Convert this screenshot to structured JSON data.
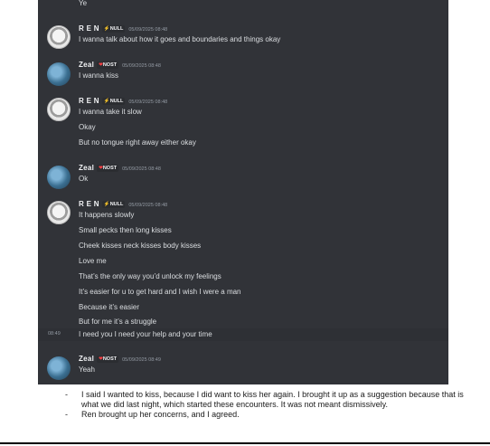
{
  "chat": {
    "top_fragment": "Ye",
    "hover_time": "08:49",
    "messages": [
      {
        "author": "R E N",
        "tag": "NULL",
        "timestamp": "05/09/2025 08:48",
        "lines": [
          "I wanna talk about how it goes and boundaries and things okay"
        ]
      },
      {
        "author": "Zeal",
        "tag": "NOST",
        "timestamp": "05/09/2025 08:48",
        "lines": [
          "I wanna kiss"
        ]
      },
      {
        "author": "R E N",
        "tag": "NULL",
        "timestamp": "05/09/2025 08:48",
        "lines": [
          "I wanna take it slow",
          "Okay",
          "But no tongue right away either okay"
        ]
      },
      {
        "author": "Zeal",
        "tag": "NOST",
        "timestamp": "05/09/2025 08:48",
        "lines": [
          "Ok"
        ]
      },
      {
        "author": "R E N",
        "tag": "NULL",
        "timestamp": "05/09/2025 08:48",
        "lines": [
          "It happens slowly",
          "Small pecks then long kisses",
          "Cheek kisses neck kisses body kisses",
          "Love me",
          "That’s the only way you’d unlock my feelings",
          "It’s easier for u to get hard and I wish I were a man",
          "Because it’s easier",
          "But for me it’s a struggle",
          "I need you I need your help and your time"
        ]
      },
      {
        "author": "Zeal",
        "tag": "NOST",
        "timestamp": "05/09/2025 08:49",
        "lines": [
          "Yeah"
        ]
      }
    ]
  },
  "notes": [
    "I said I wanted to kiss, because I did want to kiss her again. I brought it up as a suggestion because that is what we did last night, which started these encounters. It was not meant dismissively.",
    "Ren brought up her concerns, and I agreed."
  ],
  "note_bullet": "-",
  "colors": {
    "chat_bg": "#313338",
    "tag_null_icon": "#f0b232",
    "tag_nost_icon": "#f23f43"
  }
}
